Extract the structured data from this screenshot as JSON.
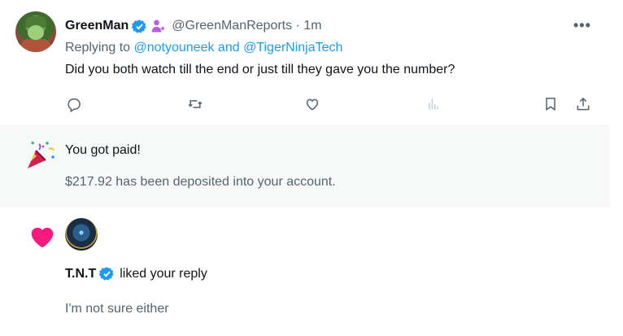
{
  "reply_tweet": {
    "author_name": "GreenMan",
    "handle": "@GreenManReports",
    "separator": "·",
    "time": "1m",
    "replying_prefix": "Replying to",
    "mentions": "@notyouneek and @TigerNinjaTech",
    "text": "Did you both watch till the end or just till they gave you the number?",
    "actions": [
      "reply-icon",
      "retweet-icon",
      "like-icon",
      "views-icon",
      "bookmark-icon",
      "share-icon"
    ]
  },
  "payment_notification": {
    "title": "You got paid!",
    "body": "$217.92 has been deposited into your account."
  },
  "like_notification": {
    "user": "T.N.T",
    "action": "liked your reply",
    "quote": "I'm not sure either"
  },
  "colors": {
    "accent": "#1d9bf0",
    "muted": "#536471",
    "heart": "#f91880",
    "highlight_bg": "#f7f9f9"
  }
}
